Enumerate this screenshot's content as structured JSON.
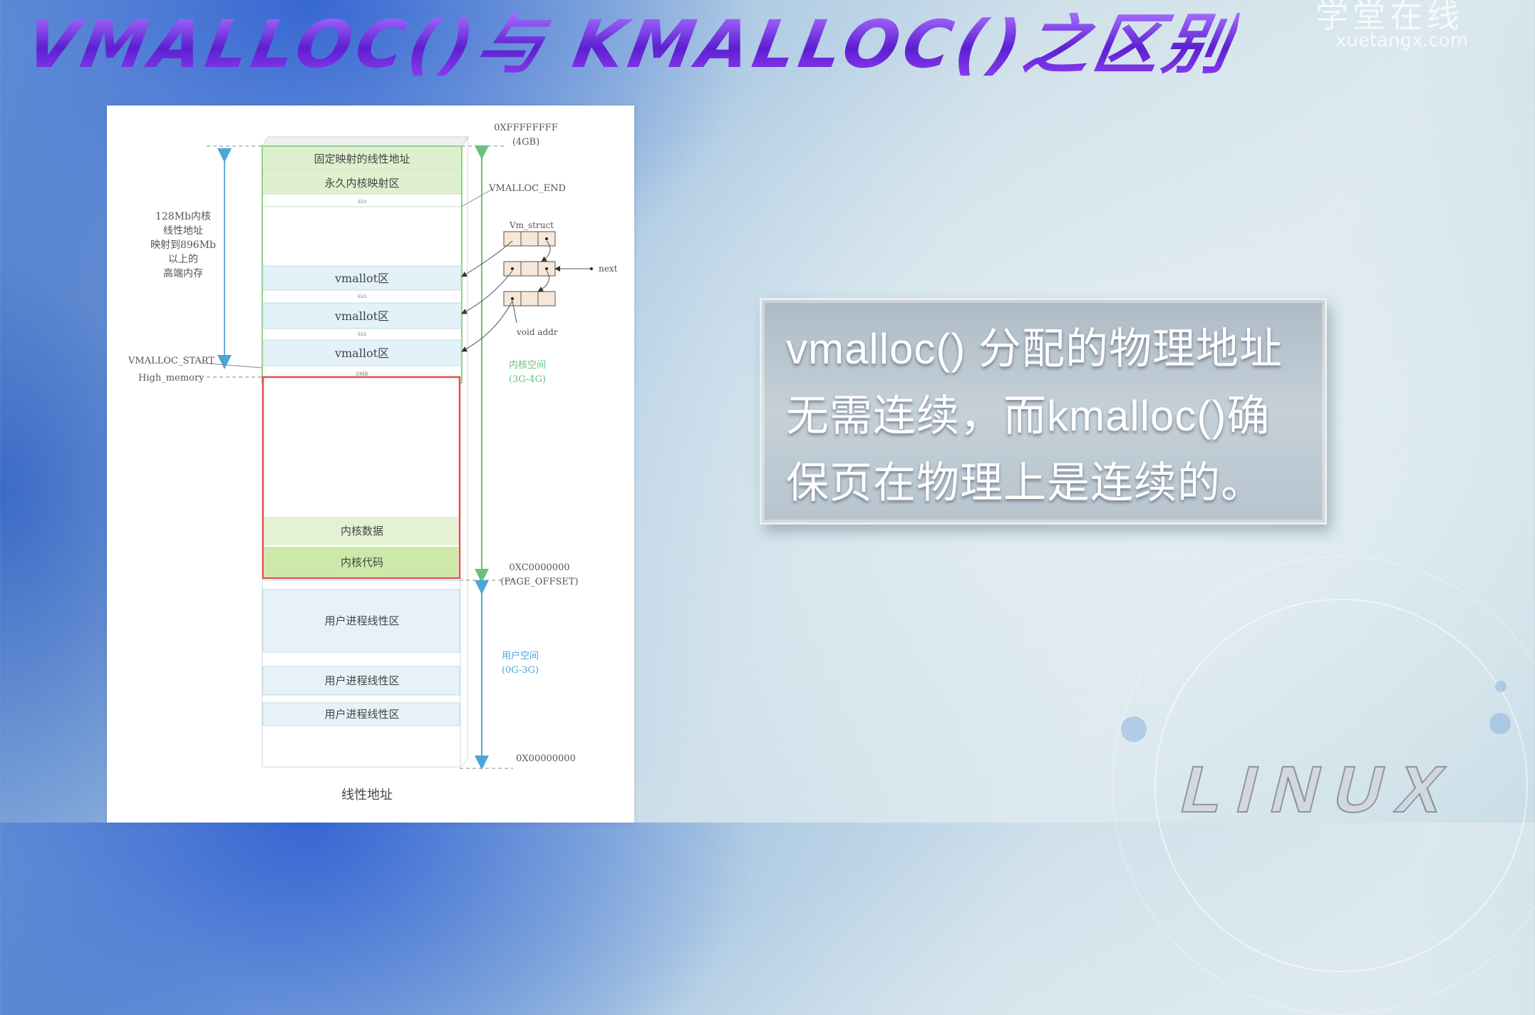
{
  "slide": {
    "title": "VMALLOC()与 KMALLOC()之区别",
    "brand": {
      "name": "学堂在线",
      "url": "xuetangx.com"
    },
    "callout": "vmalloc() 分配的物理地址无需连续，而kmalloc()确保页在物理上是连续的。",
    "logo": "LINUX"
  },
  "diagram": {
    "caption": "线性地址",
    "segments": {
      "fixmap": "固定映射的线性地址",
      "pkmap": "永久内核映射区",
      "vmalloc_1": "vmallot区",
      "vmalloc_2": "vmallot区",
      "vmalloc_3": "vmallot区",
      "kernel_data": "内核数据",
      "kernel_code": "内核代码",
      "user_1": "用户进程线性区",
      "user_2": "用户进程线性区",
      "user_3": "用户进程线性区"
    },
    "gap_labels": {
      "g1": "4kb",
      "g2": "4kb",
      "g3": "4kb",
      "g4": "8MB"
    },
    "left_note": [
      "128Mb内核",
      "线性地址",
      "映射到896Mb",
      "以上的",
      "高端内存"
    ],
    "left_labels": {
      "vmalloc_start": "VMALLOC_START",
      "high_memory": "High_memory"
    },
    "right_labels": {
      "top_addr": "0XFFFFFFFF",
      "top_size": "(4GB)",
      "vmalloc_end": "VMALLOC_END",
      "vm_struct": "Vm_struct",
      "next": "next",
      "void_addr": "void addr",
      "kernel_space": "内核空间",
      "kernel_range": "(3G-4G)",
      "page_offset_addr": "0XC0000000",
      "page_offset": "(PAGE_OFFSET)",
      "user_space": "用户空间",
      "user_range": "(0G-3G)",
      "zero_addr": "0X00000000"
    },
    "colors": {
      "kernel_outline": "#8fd18a",
      "lowmem_outline": "#d9534f",
      "vmalloc_fill": "#e3f1f8",
      "green_fill": "#dff0cf",
      "user_fill": "#e6f2f8",
      "kernel_arrow": "#67c27a",
      "user_arrow": "#4aa6d6"
    }
  }
}
